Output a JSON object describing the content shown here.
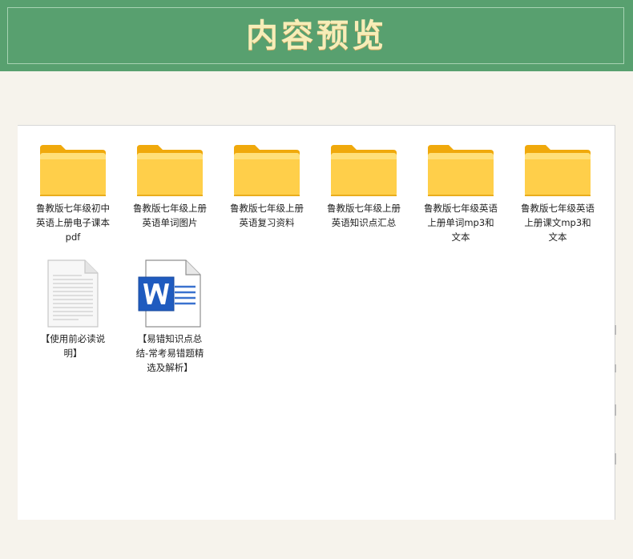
{
  "header": {
    "title": "内容预览"
  },
  "colors": {
    "header_bg": "#58a06f",
    "title_text": "#f7edb8",
    "folder_yellow": "#ffc83d",
    "word_blue": "#1f5bbf"
  },
  "files": [
    {
      "label": "鲁教版七年级初中英语上册电子课本pdf",
      "icon": "folder-icon"
    },
    {
      "label": "鲁教版七年级上册英语单词图片",
      "icon": "folder-icon"
    },
    {
      "label": "鲁教版七年级上册英语复习资料",
      "icon": "folder-icon"
    },
    {
      "label": "鲁教版七年级上册英语知识点汇总",
      "icon": "folder-icon"
    },
    {
      "label": "鲁教版七年级英语上册单词mp3和文本",
      "icon": "folder-icon"
    },
    {
      "label": "鲁教版七年级英语上册课文mp3和文本",
      "icon": "folder-icon"
    },
    {
      "label": "【使用前必读说明】",
      "icon": "text-document-icon"
    },
    {
      "label": "【易错知识点总结-常考易错题精选及解析】",
      "icon": "word-document-icon"
    }
  ]
}
